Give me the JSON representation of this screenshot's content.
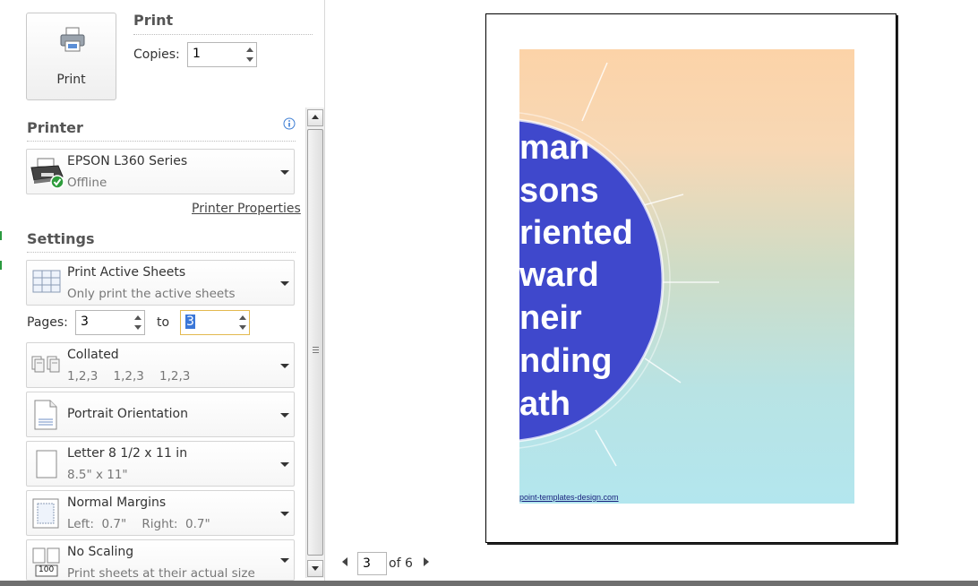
{
  "print_button": {
    "label": "Print"
  },
  "print_section": {
    "title": "Print",
    "copies_label": "Copies:",
    "copies_value": "1"
  },
  "printer": {
    "section_title": "Printer",
    "name": "EPSON L360 Series",
    "status": "Offline",
    "properties_link": "Printer Properties",
    "info_icon": "info-icon"
  },
  "settings": {
    "section_title": "Settings",
    "sheets": {
      "title": "Print Active Sheets",
      "subtitle": "Only print the active sheets"
    },
    "pages": {
      "label": "Pages:",
      "from": "3",
      "to_label": "to",
      "to": "3"
    },
    "collation": {
      "title": "Collated",
      "subtitle": "1,2,3    1,2,3    1,2,3"
    },
    "orientation": {
      "title": "Portrait Orientation"
    },
    "paper": {
      "title": "Letter 8 1/2 x 11 in",
      "subtitle": "8.5\" x 11\""
    },
    "margins": {
      "title": "Normal Margins",
      "subtitle": "Left:  0.7\"    Right:  0.7\""
    },
    "scaling": {
      "title": "No Scaling",
      "subtitle": "Print sheets at their actual size",
      "icon_label": "100"
    }
  },
  "preview": {
    "slide_lines": [
      "man",
      "sons",
      "riented",
      "ward",
      "neir",
      "nding",
      "ath"
    ],
    "footer_url": "point-templates-design.com",
    "circle_color": "#3f48cc",
    "page_current": "3",
    "page_total_label": "of 6"
  }
}
